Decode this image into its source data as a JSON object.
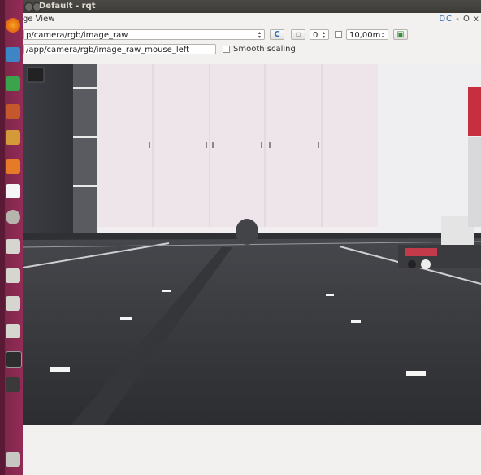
{
  "window": {
    "title": "Default - rqt"
  },
  "plugin": {
    "title": "ge View",
    "controls": "DC",
    "close": "- O x"
  },
  "toolbar": {
    "topic": "p/camera/rgb/image_raw",
    "refresh_glyph": "C",
    "rotation": "0",
    "max_range": "10,00m",
    "topic_out": "/app/camera/rgb/image_raw_mouse_left",
    "smooth_label": "Smooth scaling"
  },
  "icons": [
    "firefox-icon",
    "files-icon",
    "calc-icon",
    "impress-icon",
    "writer-icon",
    "software-center-icon",
    "amazon-icon",
    "settings-icon",
    "drive-icon",
    "terminal-icon",
    "apps-icon",
    "trash-icon"
  ],
  "colors": {
    "launcher": "#922c56",
    "titlebar": "#3c3b37",
    "accent": "#2f6fb3",
    "floor": "#3b3c40",
    "curtain": "#ece6e8"
  }
}
